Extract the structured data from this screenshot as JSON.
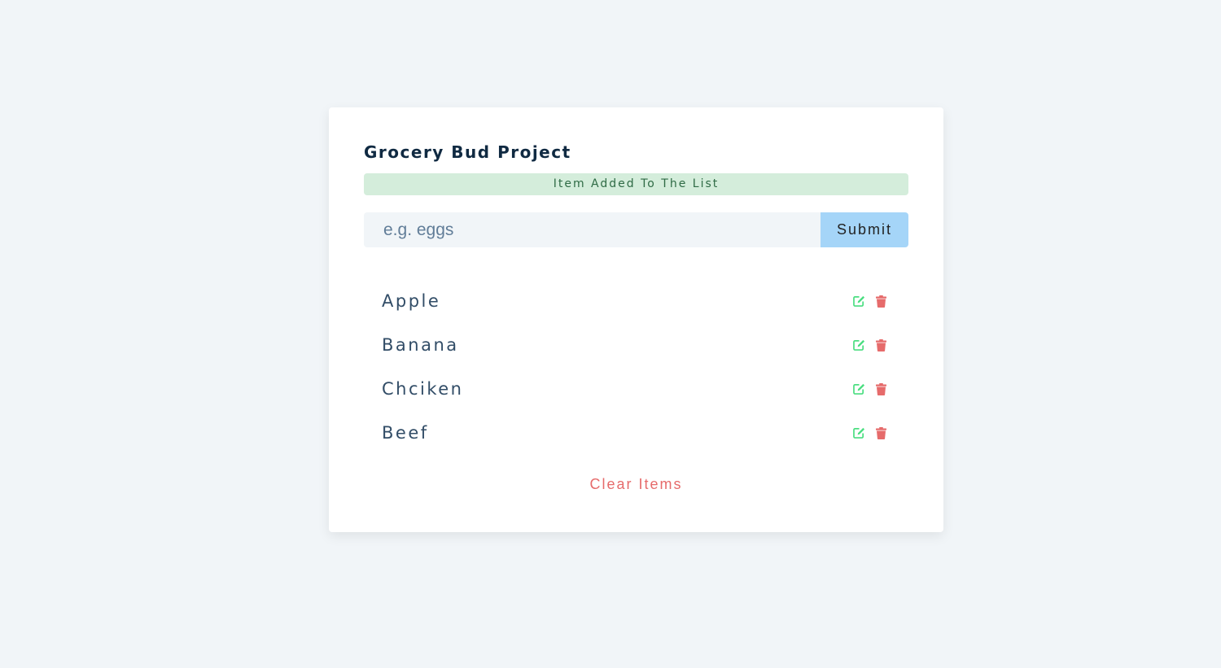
{
  "header": {
    "title": "Grocery Bud Project"
  },
  "alert": {
    "text": "Item Added To The List",
    "type": "success"
  },
  "form": {
    "input_placeholder": "e.g. eggs",
    "input_value": "",
    "submit_label": "Submit"
  },
  "items": [
    {
      "title": "Apple",
      "edit_icon": "edit-icon",
      "delete_icon": "trash-icon"
    },
    {
      "title": "Banana",
      "edit_icon": "edit-icon",
      "delete_icon": "trash-icon"
    },
    {
      "title": "Chciken",
      "edit_icon": "edit-icon",
      "delete_icon": "trash-icon"
    },
    {
      "title": "Beef",
      "edit_icon": "edit-icon",
      "delete_icon": "trash-icon"
    }
  ],
  "footer": {
    "clear_label": "Clear Items"
  },
  "colors": {
    "background": "#f1f5f8",
    "card": "#ffffff",
    "title": "#102a42",
    "alert_bg": "#d4eddb",
    "alert_text": "#2f6b45",
    "submit_bg": "#a5d5f8",
    "edit_icon": "#4ade80",
    "delete_icon": "#e66b6b",
    "clear_text": "#e66b6b"
  }
}
